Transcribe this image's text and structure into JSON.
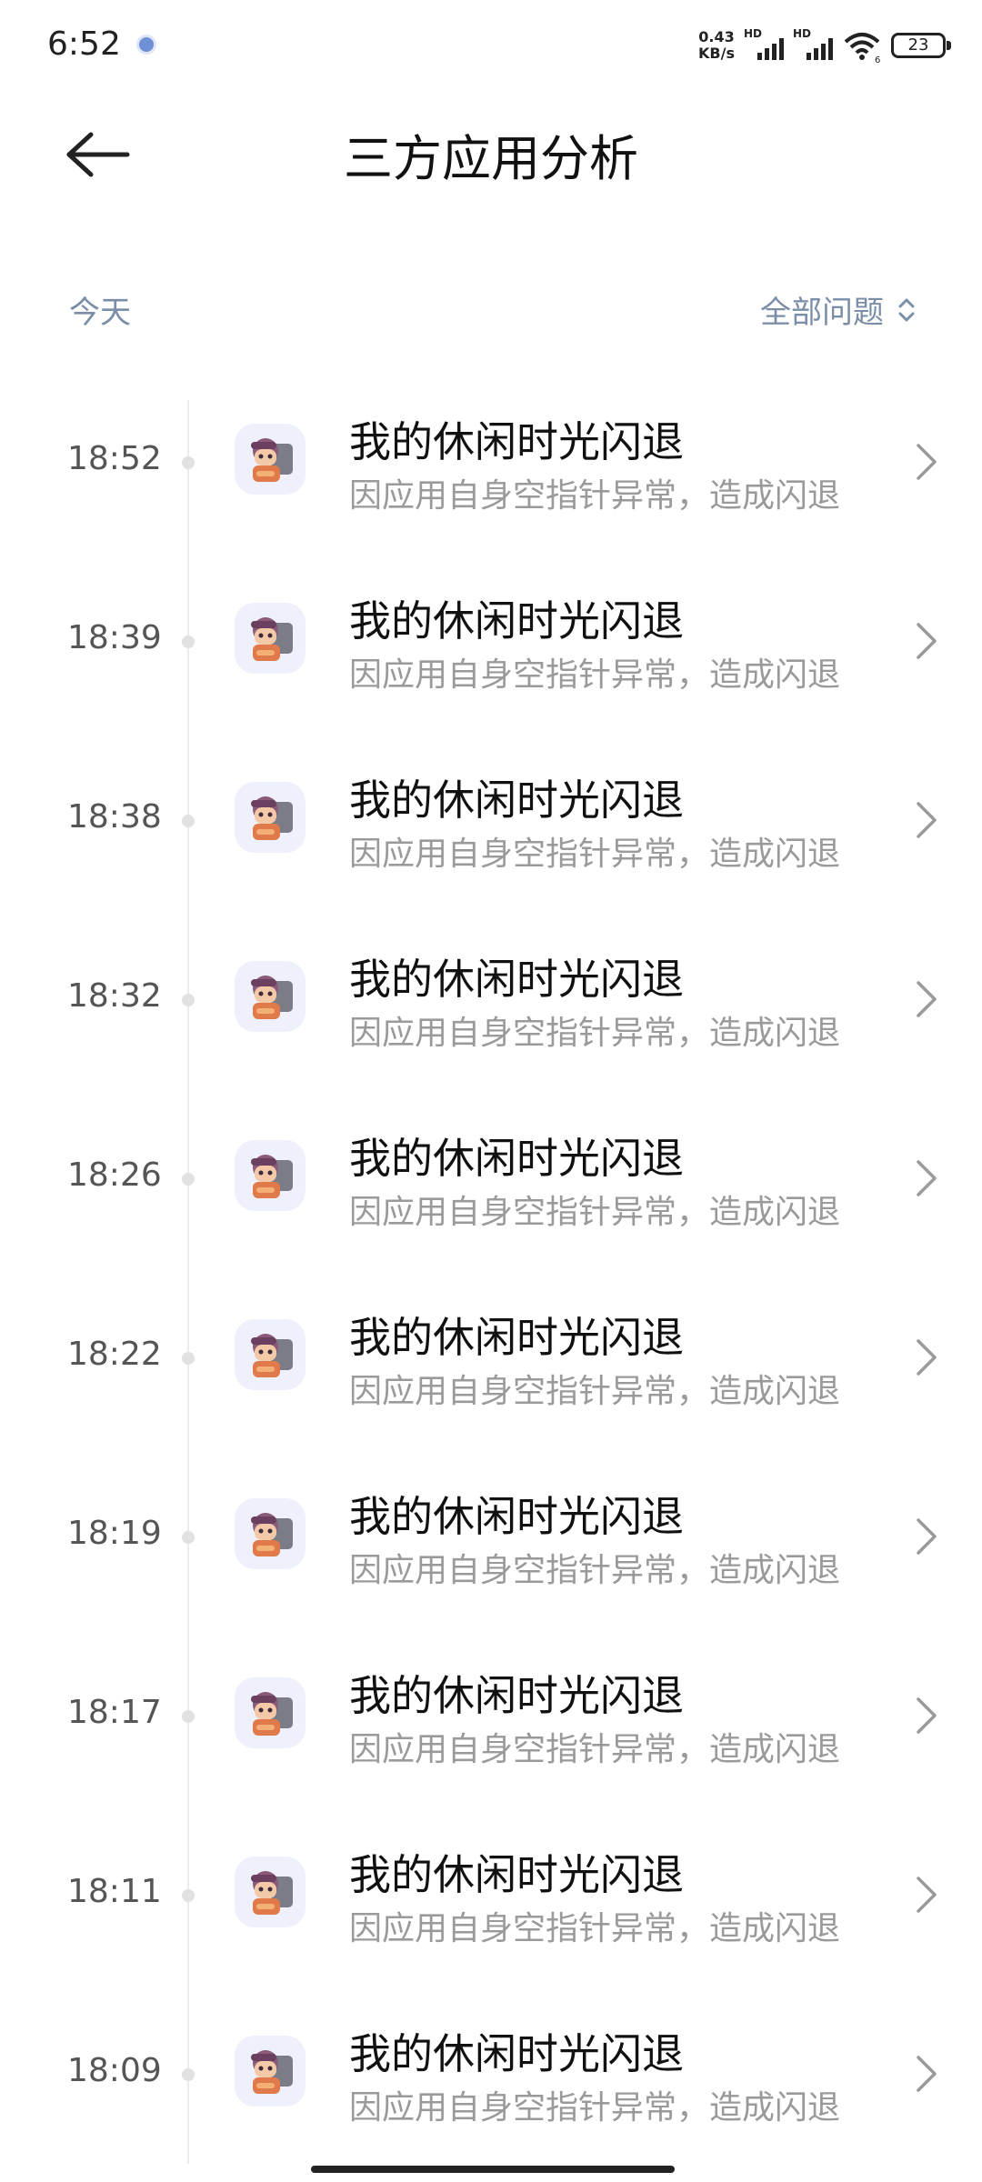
{
  "status_bar": {
    "time": "6:52",
    "net_speed_value": "0.43",
    "net_speed_unit": "KB/s",
    "sim1_label": "HD",
    "sim2_label": "HD",
    "wifi_sub": "6",
    "battery": "23"
  },
  "header": {
    "title": "三方应用分析"
  },
  "filter": {
    "date_label": "今天",
    "category_label": "全部问题"
  },
  "entries": [
    {
      "time": "18:52",
      "title": "我的休闲时光闪退",
      "subtitle": "因应用自身空指针异常，造成闪退"
    },
    {
      "time": "18:39",
      "title": "我的休闲时光闪退",
      "subtitle": "因应用自身空指针异常，造成闪退"
    },
    {
      "time": "18:38",
      "title": "我的休闲时光闪退",
      "subtitle": "因应用自身空指针异常，造成闪退"
    },
    {
      "time": "18:32",
      "title": "我的休闲时光闪退",
      "subtitle": "因应用自身空指针异常，造成闪退"
    },
    {
      "time": "18:26",
      "title": "我的休闲时光闪退",
      "subtitle": "因应用自身空指针异常，造成闪退"
    },
    {
      "time": "18:22",
      "title": "我的休闲时光闪退",
      "subtitle": "因应用自身空指针异常，造成闪退"
    },
    {
      "time": "18:19",
      "title": "我的休闲时光闪退",
      "subtitle": "因应用自身空指针异常，造成闪退"
    },
    {
      "time": "18:17",
      "title": "我的休闲时光闪退",
      "subtitle": "因应用自身空指针异常，造成闪退"
    },
    {
      "time": "18:11",
      "title": "我的休闲时光闪退",
      "subtitle": "因应用自身空指针异常，造成闪退"
    },
    {
      "time": "18:09",
      "title": "我的休闲时光闪退",
      "subtitle": "因应用自身空指针异常，造成闪退"
    }
  ],
  "icons": {
    "back": "arrow-left-icon",
    "sort": "sort-updown-icon",
    "row_chevron": "chevron-right-icon",
    "app": "app-icon-character"
  },
  "colors": {
    "accent_text": "#7b8ea8",
    "subtitle_text": "#9a9a9a",
    "icon_bg": "#eef1fb"
  }
}
